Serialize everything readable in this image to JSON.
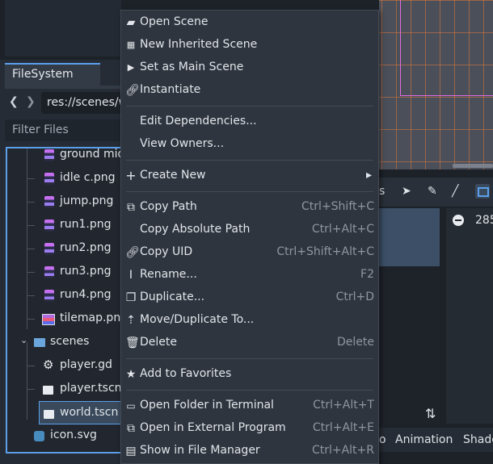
{
  "filesystem": {
    "tab_label": "FileSystem",
    "path": "res://scenes/world.tscn",
    "filter_placeholder": "Filter Files",
    "tree": [
      {
        "label": "ground mid.png",
        "icon": "sprite-icon"
      },
      {
        "label": "idle c.png",
        "icon": "sprite-icon"
      },
      {
        "label": "jump.png",
        "icon": "sprite-icon"
      },
      {
        "label": "run1.png",
        "icon": "sprite-icon"
      },
      {
        "label": "run2.png",
        "icon": "sprite-icon"
      },
      {
        "label": "run3.png",
        "icon": "sprite-icon"
      },
      {
        "label": "run4.png",
        "icon": "sprite-icon"
      },
      {
        "label": "tilemap.png",
        "icon": "tilemap-icon"
      },
      {
        "label": "scenes",
        "icon": "folder-icon"
      },
      {
        "label": "player.gd",
        "icon": "gear-icon"
      },
      {
        "label": "player.tscn",
        "icon": "clapperboard-icon"
      },
      {
        "label": "world.tscn",
        "icon": "clapperboard-icon"
      },
      {
        "label": "icon.svg",
        "icon": "godot-icon"
      }
    ]
  },
  "context_menu": {
    "items": [
      {
        "label": "Open Scene",
        "shortcut": "",
        "icon": "folder-open-icon"
      },
      {
        "label": "New Inherited Scene",
        "shortcut": "",
        "icon": "new-scene-icon"
      },
      {
        "label": "Set as Main Scene",
        "shortcut": "",
        "icon": "main-scene-icon"
      },
      {
        "label": "Instantiate",
        "shortcut": "",
        "icon": "link-icon"
      },
      {
        "label": "Edit Dependencies...",
        "shortcut": "",
        "icon": ""
      },
      {
        "label": "View Owners...",
        "shortcut": "",
        "icon": ""
      },
      {
        "label": "Create New",
        "shortcut": "",
        "icon": "plus-icon"
      },
      {
        "label": "Copy Path",
        "shortcut": "Ctrl+Shift+C",
        "icon": "copy-icon"
      },
      {
        "label": "Copy Absolute Path",
        "shortcut": "Ctrl+Alt+C",
        "icon": ""
      },
      {
        "label": "Copy UID",
        "shortcut": "Ctrl+Shift+Alt+C",
        "icon": "link-icon"
      },
      {
        "label": "Rename...",
        "shortcut": "F2",
        "icon": "rename-icon"
      },
      {
        "label": "Duplicate...",
        "shortcut": "Ctrl+D",
        "icon": "duplicate-icon"
      },
      {
        "label": "Move/Duplicate To...",
        "shortcut": "",
        "icon": "move-icon"
      },
      {
        "label": "Delete",
        "shortcut": "Delete",
        "icon": "trash-icon"
      },
      {
        "label": "Add to Favorites",
        "shortcut": "",
        "icon": "star-icon"
      },
      {
        "label": "Open Folder in Terminal",
        "shortcut": "Ctrl+Alt+T",
        "icon": "terminal-icon"
      },
      {
        "label": "Open in External Program",
        "shortcut": "Ctrl+Alt+E",
        "icon": "external-icon"
      },
      {
        "label": "Show in File Manager",
        "shortcut": "Ctrl+Alt+R",
        "icon": "filesystem-icon"
      }
    ]
  },
  "right_panel": {
    "number": "285",
    "tabs": [
      "Animation",
      "Shader"
    ],
    "partial_tab": "o",
    "partial_toolbar_text": "s"
  },
  "colors": {
    "accent": "#5b9fea",
    "menu_bg": "#2f353f",
    "viewport_frame": "#e06ce0"
  }
}
